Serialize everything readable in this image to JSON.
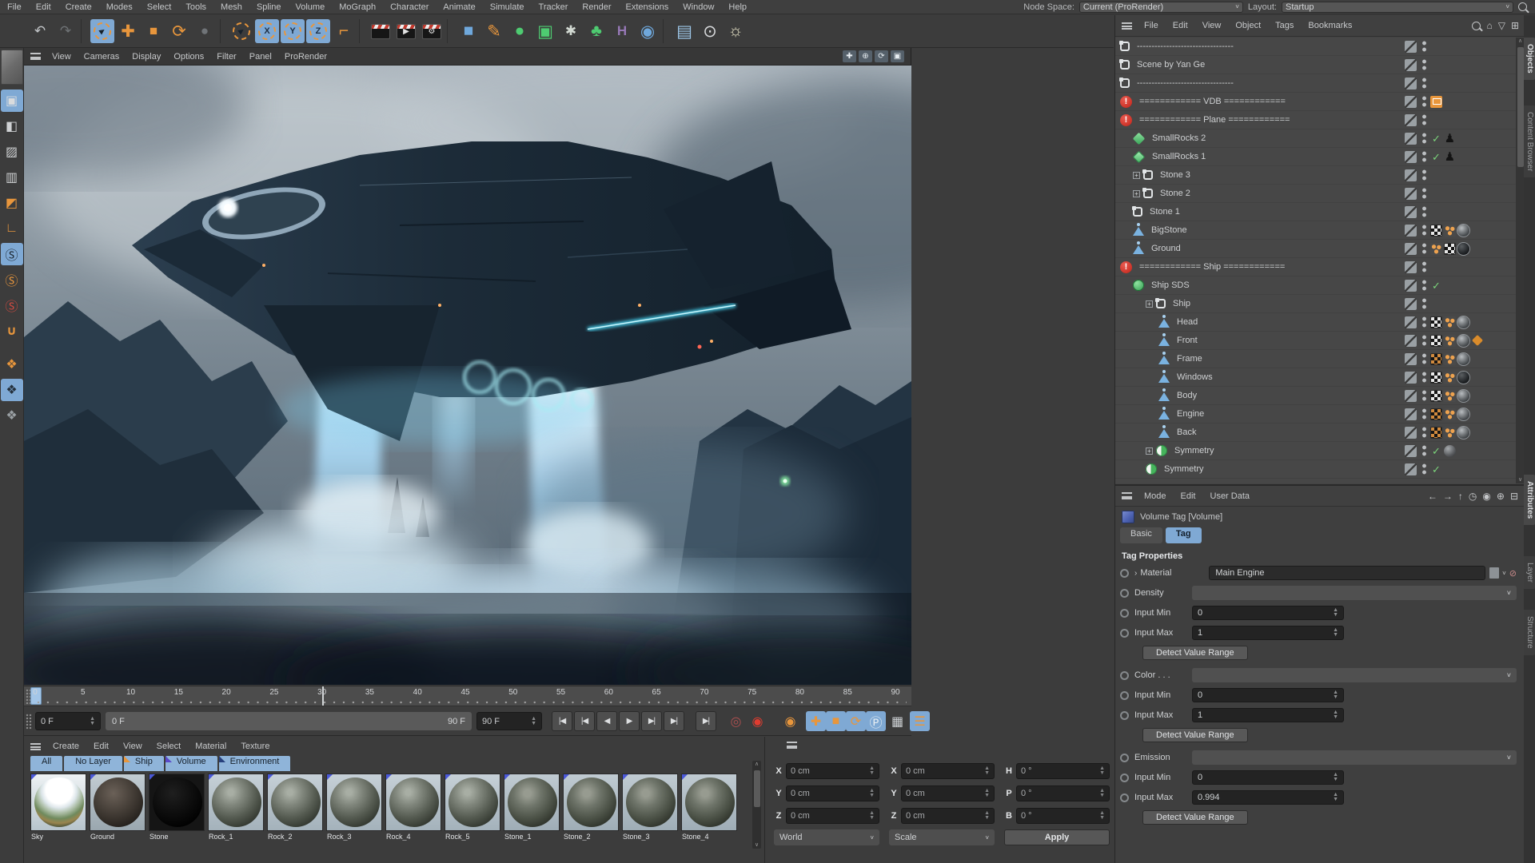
{
  "menubar": {
    "items": [
      "File",
      "Edit",
      "Create",
      "Modes",
      "Select",
      "Tools",
      "Mesh",
      "Spline",
      "Volume",
      "MoGraph",
      "Character",
      "Animate",
      "Simulate",
      "Tracker",
      "Render",
      "Extensions",
      "Window",
      "Help"
    ],
    "node_space_label": "Node Space:",
    "node_space_value": "Current (ProRender)",
    "layout_label": "Layout:",
    "layout_value": "Startup"
  },
  "main_toolbar": {
    "icons": [
      {
        "name": "undo-icon",
        "kind": "glyph",
        "glyph": "↶",
        "color": "#c2c5c8"
      },
      {
        "name": "redo-icon",
        "kind": "glyph",
        "glyph": "↷",
        "color": "#6f7376"
      },
      {
        "kind": "sep"
      },
      {
        "name": "live-selection-tool-icon",
        "kind": "ring",
        "glyph": "►",
        "selected": true
      },
      {
        "name": "move-tool-icon",
        "kind": "glyph",
        "glyph": "✚",
        "color": "#e8963c",
        "big": true
      },
      {
        "name": "scale-tool-icon",
        "kind": "glyph",
        "glyph": "■",
        "color": "#e8963c"
      },
      {
        "name": "rotate-tool-icon",
        "kind": "glyph",
        "glyph": "⟳",
        "color": "#e8963c",
        "big": true
      },
      {
        "name": "last-used-tool-icon",
        "kind": "glyph",
        "glyph": "●",
        "color": "#707478"
      },
      {
        "kind": "sep"
      },
      {
        "name": "selection-filter-icon",
        "kind": "ring",
        "glyph": "►",
        "selected": false
      },
      {
        "name": "x-axis-lock-icon",
        "kind": "axis",
        "glyph": "X"
      },
      {
        "name": "y-axis-lock-icon",
        "kind": "axis",
        "glyph": "Y"
      },
      {
        "name": "z-axis-lock-icon",
        "kind": "axis",
        "glyph": "Z"
      },
      {
        "name": "coordinate-system-icon",
        "kind": "glyph",
        "glyph": "⌐",
        "color": "#e8963c",
        "big": true
      },
      {
        "kind": "sep"
      },
      {
        "name": "render-view-icon",
        "kind": "clapper",
        "inner": ""
      },
      {
        "name": "render-picture-viewer-icon",
        "kind": "clapper",
        "inner": "▶"
      },
      {
        "name": "render-settings-icon",
        "kind": "clapper",
        "inner": "⚙"
      },
      {
        "kind": "sep"
      },
      {
        "name": "add-cube-object-icon",
        "kind": "glyph",
        "glyph": "■",
        "color": "#6fa8dc",
        "big": true
      },
      {
        "name": "spline-pen-icon",
        "kind": "glyph",
        "glyph": "✎",
        "color": "#e8963c",
        "big": true
      },
      {
        "name": "subdivision-surface-icon",
        "kind": "glyph",
        "glyph": "●",
        "color": "#4ecb71",
        "big": true
      },
      {
        "name": "generator-icon",
        "kind": "glyph",
        "glyph": "▣",
        "color": "#4ecb71",
        "big": true
      },
      {
        "name": "mograph-cloner-icon",
        "kind": "glyph",
        "glyph": "✱",
        "color": "#d3dad3"
      },
      {
        "name": "volume-builder-icon",
        "kind": "glyph",
        "glyph": "♣",
        "color": "#4ecb71",
        "big": true
      },
      {
        "name": "fields-icon",
        "kind": "glyph",
        "glyph": "H",
        "color": "#9678b6",
        "bold": true
      },
      {
        "name": "simulate-icon",
        "kind": "glyph",
        "glyph": "◉",
        "color": "#6fa8dc",
        "big": true
      },
      {
        "kind": "sep"
      },
      {
        "name": "floor-object-icon",
        "kind": "glyph",
        "glyph": "▤",
        "color": "#9ec7e8",
        "big": true
      },
      {
        "name": "camera-object-icon",
        "kind": "glyph",
        "glyph": "⊙",
        "color": "#d8dadc",
        "big": true
      },
      {
        "name": "light-object-icon",
        "kind": "glyph",
        "glyph": "☼",
        "color": "#e8e4c8",
        "big": true
      }
    ]
  },
  "left_toolbar": {
    "icons": [
      {
        "name": "make-editable-icon",
        "glyph": "▣",
        "color": "#d9dbdd",
        "selected": true
      },
      {
        "name": "model-mode-icon",
        "glyph": "◧",
        "color": "#cfd1d3"
      },
      {
        "name": "texture-mode-icon",
        "glyph": "▨",
        "color": "#cfd1d3"
      },
      {
        "name": "workplane-mode-icon",
        "glyph": "▥",
        "color": "#cfd1d3"
      },
      {
        "name": "polygons-mode-icon",
        "glyph": "◩",
        "color": "#e8963c"
      },
      {
        "name": "axis-mode-icon",
        "glyph": "∟",
        "color": "#e8963c",
        "bold": true
      },
      {
        "name": "viewport-solo-single-icon",
        "glyph": "Ⓢ",
        "color": "#1d2833",
        "selected": true
      },
      {
        "name": "viewport-solo-hierarchy-icon",
        "glyph": "Ⓢ",
        "color": "#e8963c"
      },
      {
        "name": "viewport-solo-off-icon",
        "glyph": "Ⓢ",
        "color": "#d24a40"
      },
      {
        "name": "snap-settings-icon",
        "glyph": "∪",
        "color": "#e8963c",
        "bold": true
      },
      {
        "gap": true
      },
      {
        "name": "workplane-icon",
        "glyph": "❖",
        "color": "#e8963c"
      },
      {
        "name": "locked-workplane-icon",
        "glyph": "❖",
        "color": "#24303c",
        "selected": true
      },
      {
        "name": "planar-workplane-icon",
        "glyph": "❖",
        "color": "#9aa0a4"
      }
    ]
  },
  "viewport": {
    "menus": [
      "View",
      "Cameras",
      "Display",
      "Options",
      "Filter",
      "Panel",
      "ProRender"
    ],
    "nav_icons": [
      {
        "name": "pan-view-icon",
        "glyph": "✚"
      },
      {
        "name": "zoom-view-icon",
        "glyph": "⊕"
      },
      {
        "name": "rotate-view-icon",
        "glyph": "⟳"
      },
      {
        "name": "toggle-view-icon",
        "glyph": "▣"
      }
    ]
  },
  "timeline": {
    "max_frame": 90,
    "tick_step": 5,
    "marker_frame": 30,
    "current_frame_label": "0 F",
    "range_start_label": "0 F",
    "range_end_label": "90 F",
    "end_frame_label": "90 F"
  },
  "transport": {
    "buttons": [
      {
        "name": "goto-start-button",
        "glyph": "|◀"
      },
      {
        "name": "previous-key-button",
        "glyph": "|◀"
      },
      {
        "name": "play-backwards-button",
        "glyph": "◀"
      },
      {
        "name": "play-forwards-button",
        "glyph": "▶"
      },
      {
        "name": "next-frame-button",
        "glyph": "▶|"
      },
      {
        "name": "next-key-button",
        "glyph": "▶|"
      }
    ],
    "end_button": {
      "name": "goto-end-button",
      "glyph": "▶|"
    },
    "record_icons": [
      {
        "name": "record-active-objects-icon",
        "glyph": "◎",
        "color": "#b05050"
      },
      {
        "name": "autokeying-icon",
        "glyph": "◉",
        "color": "#e03c30"
      }
    ],
    "key_icon": {
      "name": "set-keyframe-icon",
      "glyph": "◉",
      "color": "#e8963c"
    },
    "key_toggles": [
      {
        "name": "key-position-icon",
        "glyph": "✚",
        "color": "#e8963c"
      },
      {
        "name": "key-scale-icon",
        "glyph": "■",
        "color": "#e8963c"
      },
      {
        "name": "key-rotation-icon",
        "glyph": "⟳",
        "color": "#e8963c"
      },
      {
        "name": "key-parameter-icon",
        "glyph": "Ⓟ",
        "color": "#e8eef2"
      }
    ],
    "pla_icon": {
      "name": "key-pla-icon",
      "glyph": "▦",
      "color": "#cfd3d6"
    },
    "stack_icon": {
      "name": "animation-palette-icon",
      "glyph": "☰",
      "color": "#e8963c"
    }
  },
  "materials": {
    "menus": [
      "Create",
      "Edit",
      "View",
      "Select",
      "Material",
      "Texture"
    ],
    "tabs": [
      {
        "label": "All",
        "corner": null
      },
      {
        "label": "No Layer",
        "corner": null
      },
      {
        "label": "Ship",
        "corner": "#e8963c"
      },
      {
        "label": "Volume",
        "corner": "#5b49c9"
      },
      {
        "label": "Environment",
        "corner": "#27407c"
      }
    ],
    "items": [
      {
        "name": "Sky",
        "kind": "sky"
      },
      {
        "name": "Ground",
        "kind": "ground"
      },
      {
        "name": "Stone",
        "kind": "black"
      },
      {
        "name": "Rock_1",
        "kind": "rock"
      },
      {
        "name": "Rock_2",
        "kind": "rock"
      },
      {
        "name": "Rock_3",
        "kind": "rock"
      },
      {
        "name": "Rock_4",
        "kind": "rock"
      },
      {
        "name": "Rock_5",
        "kind": "rock"
      },
      {
        "name": "Stone_1",
        "kind": "rock2"
      },
      {
        "name": "Stone_2",
        "kind": "rock2"
      },
      {
        "name": "Stone_3",
        "kind": "rock2"
      },
      {
        "name": "Stone_4",
        "kind": "rock2"
      }
    ]
  },
  "coordinates": {
    "groups": [
      {
        "name": "position",
        "rows": [
          {
            "label": "X",
            "value": "0 cm"
          },
          {
            "label": "Y",
            "value": "0 cm"
          },
          {
            "label": "Z",
            "value": "0 cm"
          }
        ],
        "dropdown": "World"
      },
      {
        "name": "size",
        "rows": [
          {
            "label": "X",
            "value": "0 cm"
          },
          {
            "label": "Y",
            "value": "0 cm"
          },
          {
            "label": "Z",
            "value": "0 cm"
          }
        ],
        "dropdown": "Scale"
      },
      {
        "name": "rotation",
        "rows": [
          {
            "label": "H",
            "value": "0 °"
          },
          {
            "label": "P",
            "value": "0 °"
          },
          {
            "label": "B",
            "value": "0 °"
          }
        ],
        "button": "Apply"
      }
    ]
  },
  "object_manager": {
    "menus": [
      "File",
      "Edit",
      "View",
      "Object",
      "Tags",
      "Bookmarks"
    ],
    "tree": [
      {
        "icon": "null",
        "label": "---------------------------------",
        "indent": 0,
        "tags": []
      },
      {
        "icon": "null",
        "label": "Scene by Yan Ge",
        "indent": 0,
        "tags": []
      },
      {
        "icon": "null",
        "label": "---------------------------------",
        "indent": 0,
        "tags": []
      },
      {
        "icon": "alert",
        "label": "============ VDB ============",
        "indent": 0,
        "tags": [
          "vdb"
        ]
      },
      {
        "icon": "alert",
        "label": "============ Plane ============",
        "indent": 0,
        "tags": []
      },
      {
        "icon": "cloner",
        "label": "SmallRocks 2",
        "indent": 1,
        "tags": [
          "check",
          "figure"
        ]
      },
      {
        "icon": "matrix",
        "label": "SmallRocks 1",
        "indent": 1,
        "tags": [
          "check",
          "figure"
        ]
      },
      {
        "icon": "null",
        "label": "Stone 3",
        "indent": 1,
        "exp": true,
        "tags": []
      },
      {
        "icon": "null",
        "label": "Stone 2",
        "indent": 1,
        "exp": true,
        "tags": []
      },
      {
        "icon": "null",
        "label": "Stone 1",
        "indent": 1,
        "tags": []
      },
      {
        "icon": "poly",
        "label": "BigStone",
        "indent": 1,
        "tags": [
          "checker",
          "phong",
          "mat"
        ]
      },
      {
        "icon": "poly",
        "label": "Ground",
        "indent": 1,
        "tags": [
          "phong",
          "checker",
          "mat-dark"
        ]
      },
      {
        "icon": "alert",
        "label": "============ Ship ============",
        "indent": 0,
        "tags": []
      },
      {
        "icon": "sds",
        "label": "Ship SDS",
        "indent": 1,
        "tags": [
          "check"
        ]
      },
      {
        "icon": "null",
        "label": "Ship",
        "indent": 2,
        "exp": true,
        "tags": []
      },
      {
        "icon": "poly",
        "label": "Head",
        "indent": 3,
        "tags": [
          "checker",
          "phong",
          "mat"
        ]
      },
      {
        "icon": "poly",
        "label": "Front",
        "indent": 3,
        "tags": [
          "checker",
          "phong",
          "mat",
          "extra"
        ]
      },
      {
        "icon": "poly",
        "label": "Frame",
        "indent": 3,
        "tags": [
          "checker-o",
          "phong",
          "mat"
        ]
      },
      {
        "icon": "poly",
        "label": "Windows",
        "indent": 3,
        "tags": [
          "checker",
          "phong",
          "mat-dark"
        ]
      },
      {
        "icon": "poly",
        "label": "Body",
        "indent": 3,
        "tags": [
          "checker",
          "phong",
          "mat"
        ]
      },
      {
        "icon": "poly",
        "label": "Engine",
        "indent": 3,
        "tags": [
          "checker-o",
          "phong",
          "mat"
        ]
      },
      {
        "icon": "poly",
        "label": "Back",
        "indent": 3,
        "tags": [
          "checker-o",
          "phong",
          "mat"
        ]
      },
      {
        "icon": "sym",
        "label": "Symmetry",
        "indent": 2,
        "exp": true,
        "tags": [
          "check",
          "mat-gray"
        ]
      },
      {
        "icon": "sym",
        "label": "Symmetry",
        "indent": 2,
        "tags": [
          "check"
        ]
      }
    ]
  },
  "attributes": {
    "menus": [
      "Mode",
      "Edit",
      "User Data"
    ],
    "nav_icons": [
      "←",
      "→",
      "↑",
      "◷",
      "◉",
      "⊕",
      "⊟"
    ],
    "title": "Volume Tag [Volume]",
    "tabs": [
      {
        "label": "Basic",
        "active": false
      },
      {
        "label": "Tag",
        "active": true
      }
    ],
    "section": "Tag Properties",
    "material_row": {
      "label": "Material",
      "value": "Main Engine"
    },
    "groups": [
      {
        "field": "Density",
        "rows": [
          {
            "label": "Input Min",
            "value": "0"
          },
          {
            "label": "Input Max",
            "value": "1"
          }
        ],
        "button": "Detect Value Range"
      },
      {
        "field": "Color . . .",
        "rows": [
          {
            "label": "Input Min",
            "value": "0"
          },
          {
            "label": "Input Max",
            "value": "1"
          }
        ],
        "button": "Detect Value Range"
      },
      {
        "field": "Emission",
        "rows": [
          {
            "label": "Input Min",
            "value": "0"
          },
          {
            "label": "Input Max",
            "value": "0.994"
          }
        ],
        "button": "Detect Value Range"
      }
    ]
  },
  "right_tabs": {
    "top": [
      {
        "label": "Objects",
        "active": true
      },
      {
        "label": "Content Browser",
        "active": false
      }
    ],
    "bottom": [
      {
        "label": "Attributes",
        "active": true
      },
      {
        "label": "Layer",
        "active": false
      },
      {
        "label": "Structure",
        "active": false
      }
    ]
  },
  "colors": {
    "accent_orange": "#e8963c",
    "accent_blue": "#7fa9d4",
    "alert_red": "#d23b33",
    "green": "#57c66d",
    "engine_cyan": "#49e0ff"
  }
}
